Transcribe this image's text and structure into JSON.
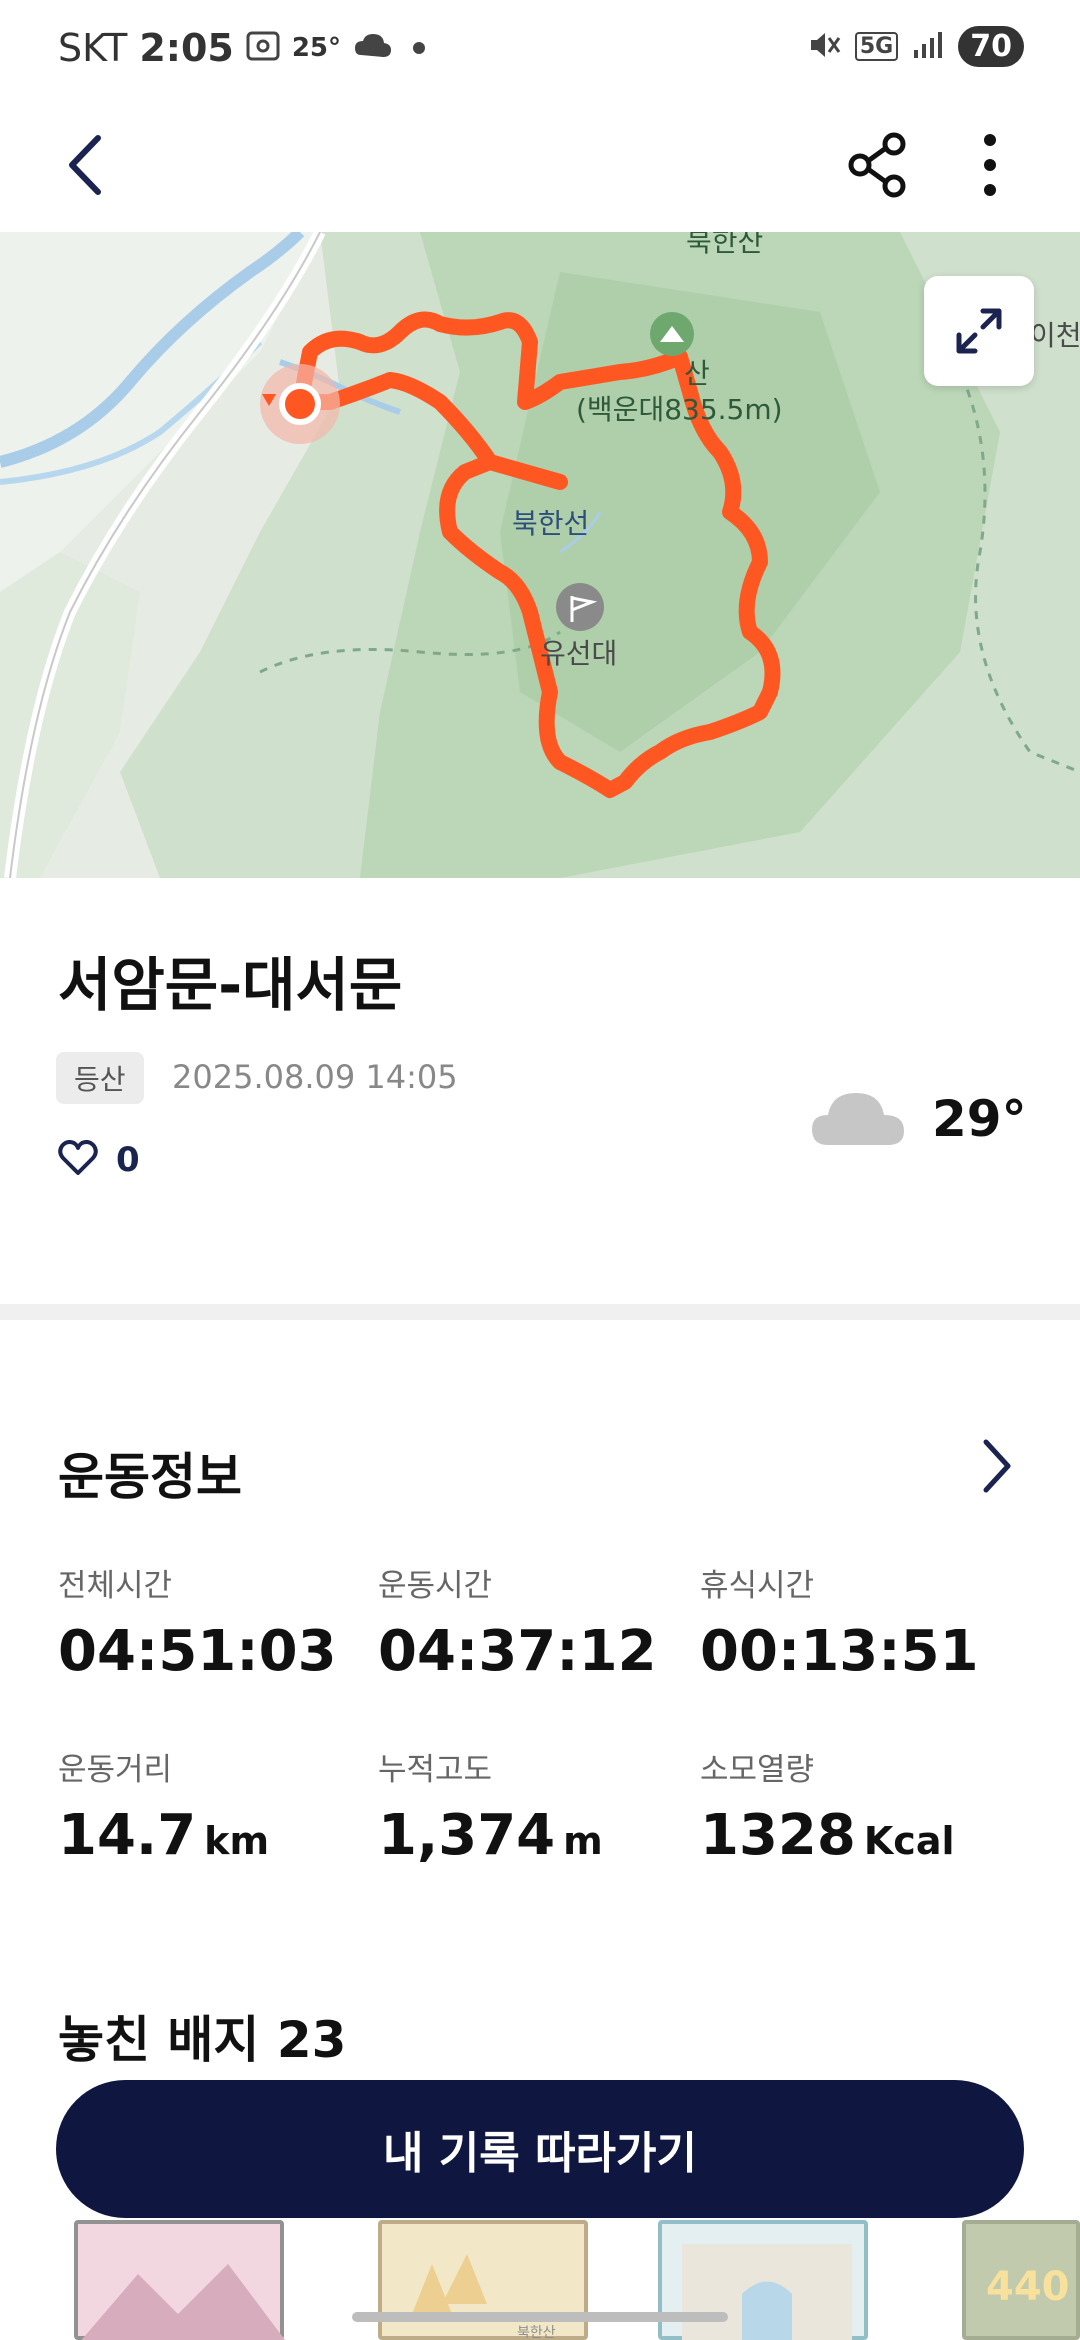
{
  "status_bar": {
    "carrier": "SKT",
    "time": "2:05",
    "temperature": "25°",
    "network": "5G",
    "battery": "70"
  },
  "map": {
    "labels": {
      "peak": "산\n(백운대 835.5m)",
      "peak_line1": "산",
      "peak_line2": "(백운대835.5m)",
      "bukhanseon": "북한선",
      "yuseondae": "유선대",
      "right_edge": "이천",
      "top_edge": "북한산"
    },
    "route_color": "#ff5722"
  },
  "route": {
    "title": "서암문-대서문",
    "tag": "등산",
    "date": "2025.08.09 14:05",
    "like_count": "0",
    "weather_temp": "29°",
    "weather_icon": "cloud-icon"
  },
  "stats": {
    "section_title": "운동정보",
    "items": [
      {
        "label": "전체시간",
        "value": "04:51:03",
        "unit": ""
      },
      {
        "label": "운동시간",
        "value": "04:37:12",
        "unit": ""
      },
      {
        "label": "휴식시간",
        "value": "00:13:51",
        "unit": ""
      },
      {
        "label": "운동거리",
        "value": "14.7",
        "unit": "km"
      },
      {
        "label": "누적고도",
        "value": "1,374",
        "unit": "m"
      },
      {
        "label": "소모열량",
        "value": "1328",
        "unit": "Kcal"
      }
    ]
  },
  "badges": {
    "title": "놓친 배지 23",
    "thumb2_text": "북한산",
    "thumb4_text": "440"
  },
  "cta": {
    "label": "내 기록 따라가기"
  },
  "colors": {
    "accent": "#0f1740",
    "route": "#ff5722"
  }
}
